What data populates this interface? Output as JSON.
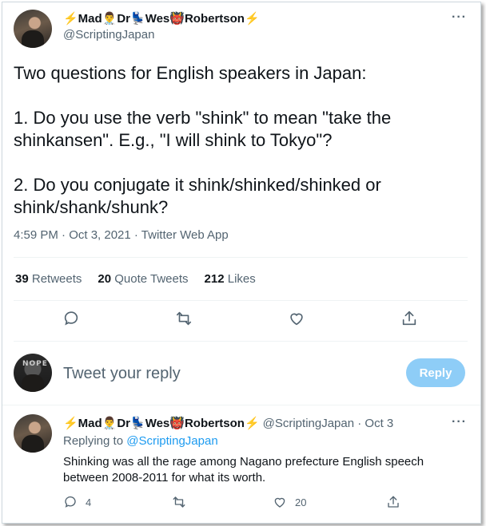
{
  "tweet": {
    "author": {
      "display_name": "⚡Mad👨‍⚕️Dr💺Wes👹Robertson⚡",
      "handle": "@ScriptingJapan",
      "avatar": "profile-photo"
    },
    "paragraphs": [
      "Two questions for English speakers in Japan:",
      "1. Do you use the verb \"shink\" to mean \"take the shinkansen\". E.g., \"I will shink to Tokyo\"?",
      "2. Do you conjugate it shink/shinked/shinked or shink/shank/shunk?"
    ],
    "timestamp": "4:59 PM · Oct 3, 2021 · Twitter Web App",
    "stats": {
      "retweets_count": "39",
      "retweets_label": "Retweets",
      "quotes_count": "20",
      "quotes_label": "Quote Tweets",
      "likes_count": "212",
      "likes_label": "Likes"
    },
    "actions": [
      "reply-icon",
      "retweet-icon",
      "like-icon",
      "share-icon"
    ],
    "more_label": "···"
  },
  "composer": {
    "placeholder": "Tweet your reply",
    "button_label": "Reply",
    "avatar_text": "NOPE"
  },
  "reply": {
    "display_name": "⚡Mad👨‍⚕️Dr💺Wes👹Robertson⚡",
    "handle_date": "@ScriptingJapan · Oct 3",
    "replying_prefix": "Replying to ",
    "replying_handle": "@ScriptingJapan",
    "text": "Shinking was all the rage among Nagano prefecture English speech between 2008-2011 for what its worth.",
    "reply_count": "4",
    "like_count": "20",
    "more_label": "···"
  },
  "colors": {
    "accent": "#1d9bf0",
    "reply_button_disabled": "#8ecdf7",
    "secondary_text": "#536471",
    "divider": "#eff3f4"
  }
}
